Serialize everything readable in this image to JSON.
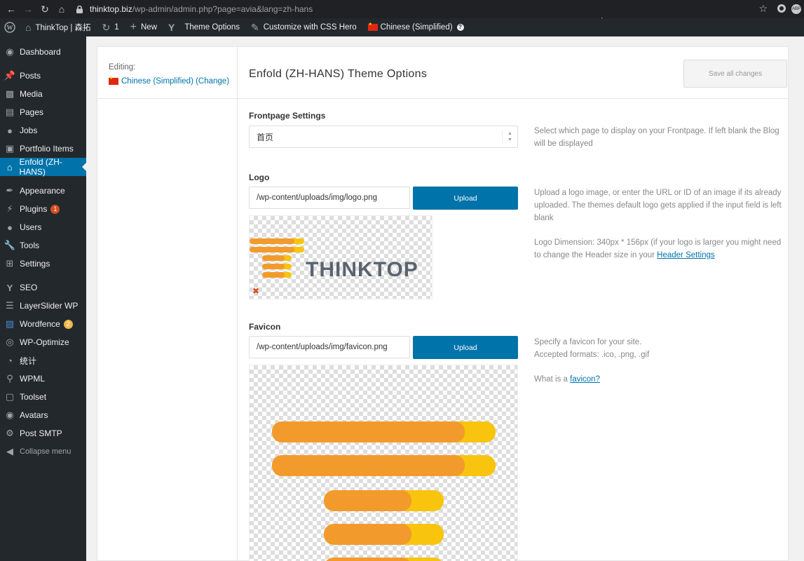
{
  "browser": {
    "url_domain": "thinktop.biz",
    "url_path": "/wp-admin/admin.php?page=avia&lang=zh-hans",
    "ext_label": "ABP"
  },
  "admin_bar": {
    "site_name": "ThinkTop | 森拓",
    "updates_count": "1",
    "new_label": "New",
    "theme_options": "Theme Options",
    "css_hero": "Customize with CSS Hero",
    "language": "Chinese (Simplified)"
  },
  "sidebar": {
    "items": [
      {
        "label": "Dashboard",
        "icon": "dashboard-icon"
      },
      {
        "label": "Posts",
        "icon": "pin-icon"
      },
      {
        "label": "Media",
        "icon": "media-icon"
      },
      {
        "label": "Pages",
        "icon": "pages-icon"
      },
      {
        "label": "Jobs",
        "icon": "user-icon"
      },
      {
        "label": "Portfolio Items",
        "icon": "portfolio-icon"
      },
      {
        "label": "Enfold (ZH-HANS)",
        "icon": "home-icon"
      },
      {
        "label": "Appearance",
        "icon": "brush-icon"
      },
      {
        "label": "Plugins",
        "icon": "plugin-icon",
        "badge": "1"
      },
      {
        "label": "Users",
        "icon": "users-icon"
      },
      {
        "label": "Tools",
        "icon": "wrench-icon"
      },
      {
        "label": "Settings",
        "icon": "settings-icon"
      },
      {
        "label": "SEO",
        "icon": "yoast-icon"
      },
      {
        "label": "LayerSlider WP",
        "icon": "layers-icon"
      },
      {
        "label": "Wordfence",
        "icon": "wordfence-icon",
        "badge": "2"
      },
      {
        "label": "WP-Optimize",
        "icon": "optimize-icon"
      },
      {
        "label": "统计",
        "icon": "chart-pie-icon"
      },
      {
        "label": "WPML",
        "icon": "wpml-icon"
      },
      {
        "label": "Toolset",
        "icon": "toolset-icon"
      },
      {
        "label": "Avatars",
        "icon": "avatar-icon"
      },
      {
        "label": "Post SMTP",
        "icon": "gear-icon"
      }
    ],
    "collapse_label": "Collapse menu"
  },
  "editing": {
    "label": "Editing:",
    "language": "Chinese (Simplified) (Change)"
  },
  "main": {
    "title": "Enfold (ZH-HANS) Theme Options",
    "save_label": "Save all changes",
    "frontpage": {
      "title": "Frontpage Settings",
      "value": "首页",
      "desc": "Select which page to display on your Frontpage. If left blank the Blog will be displayed"
    },
    "logo": {
      "title": "Logo",
      "value": "/wp-content/uploads/img/logo.png",
      "upload_label": "Upload",
      "desc1": "Upload a logo image, or enter the URL or ID of an image if its already uploaded. The themes default logo gets applied if the input field is left blank",
      "desc2_prefix": "Logo Dimension: 340px * 156px (if your logo is larger you might need to change the Header size in your ",
      "desc2_link": "Header Settings",
      "brand_text": "THINKTOP"
    },
    "favicon": {
      "title": "Favicon",
      "value": "/wp-content/uploads/img/favicon.png",
      "upload_label": "Upload",
      "desc1": "Specify a favicon for your site.",
      "desc2": "Accepted formats: .ico, .png, .gif",
      "desc3_prefix": "What is a ",
      "desc3_link": "favicon?"
    }
  },
  "colors": {
    "wp_blue": "#0073aa",
    "admin_dark": "#23282d",
    "logo_orange": "#f29b2c",
    "logo_yellow": "#f8c40d",
    "logo_gray": "#5a6470"
  }
}
